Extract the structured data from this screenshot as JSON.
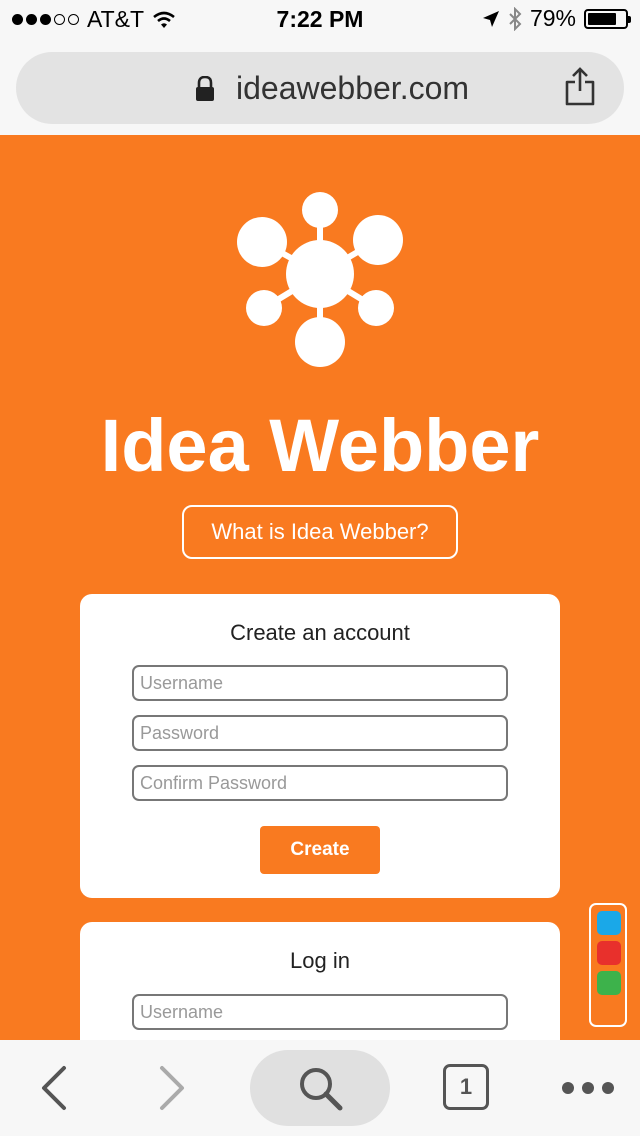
{
  "status_bar": {
    "carrier": "AT&T",
    "time": "7:22 PM",
    "battery": "79%",
    "battery_level": 0.79,
    "signal_bars": 3,
    "signal_total": 5
  },
  "browser": {
    "url": "ideawebber.com"
  },
  "page": {
    "app_title": "Idea Webber",
    "what_is_button": "What is Idea Webber?",
    "accent_color": "#f97a20"
  },
  "create_account": {
    "heading": "Create an account",
    "username_placeholder": "Username",
    "password_placeholder": "Password",
    "confirm_password_placeholder": "Confirm Password",
    "create_button": "Create"
  },
  "login": {
    "heading": "Log in",
    "username_placeholder": "Username"
  },
  "color_palette": [
    "#1aa8e8",
    "#e8302c",
    "#3db24b"
  ],
  "toolbar": {
    "tab_count": "1"
  }
}
